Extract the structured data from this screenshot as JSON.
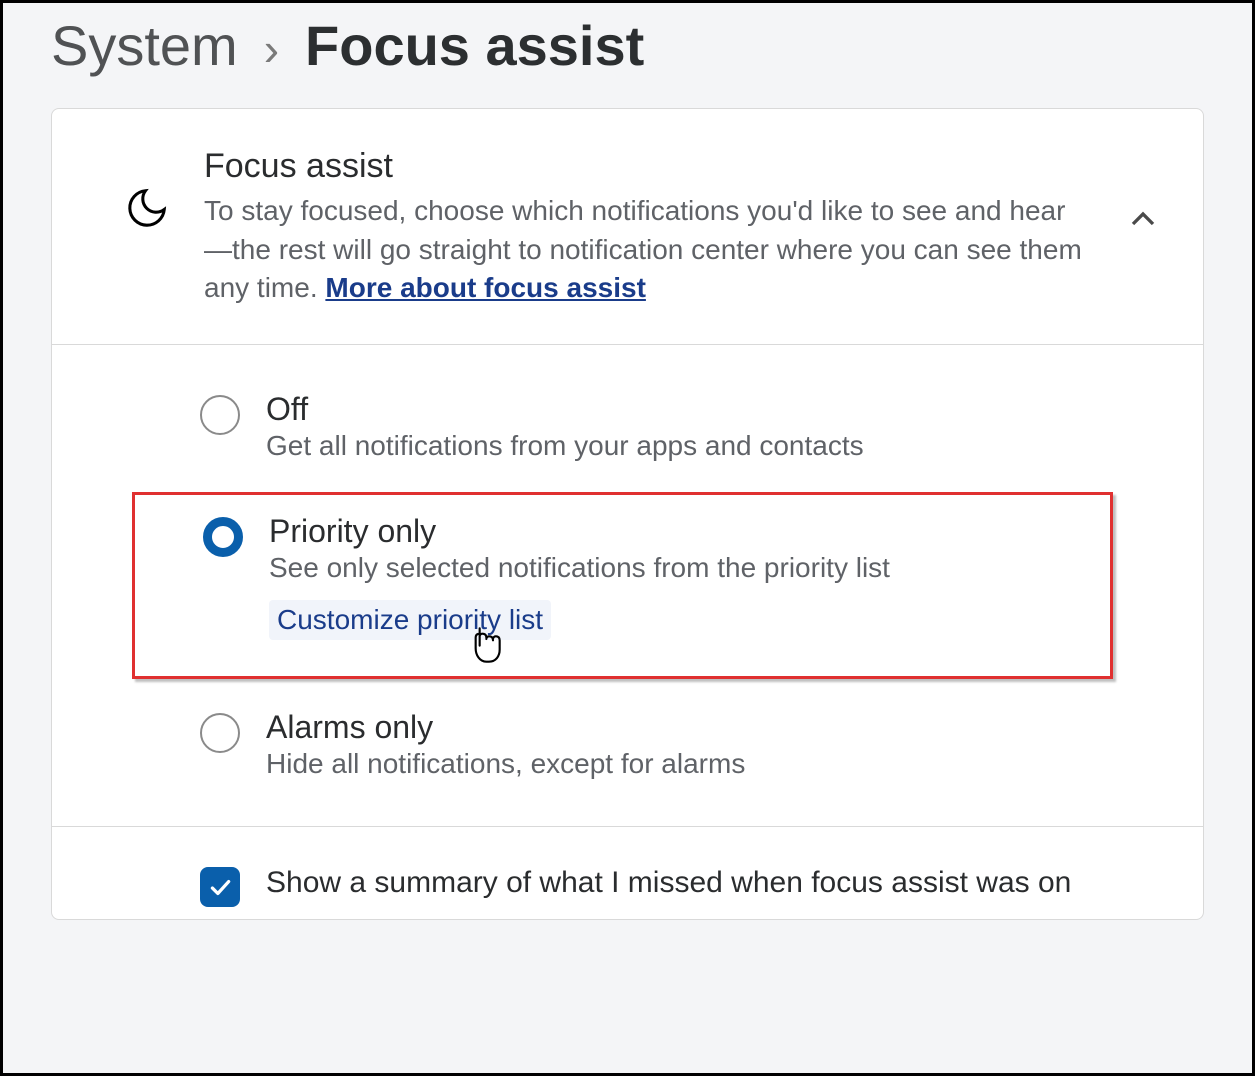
{
  "breadcrumb": {
    "parent": "System",
    "separator": "›",
    "current": "Focus assist"
  },
  "header": {
    "title": "Focus assist",
    "description_prefix": "To stay focused, choose which notifications you'd like to see and hear—the rest will go straight to notification center where you can see them any time.  ",
    "more_link": "More about focus assist"
  },
  "options": [
    {
      "title": "Off",
      "description": "Get all notifications from your apps and contacts",
      "selected": false
    },
    {
      "title": "Priority only",
      "description": "See only selected notifications from the priority list",
      "selected": true,
      "sub_link": "Customize priority list"
    },
    {
      "title": "Alarms only",
      "description": "Hide all notifications, except for alarms",
      "selected": false
    }
  ],
  "footer": {
    "checkbox_label": "Show a summary of what I missed when focus assist was on",
    "checked": true
  }
}
